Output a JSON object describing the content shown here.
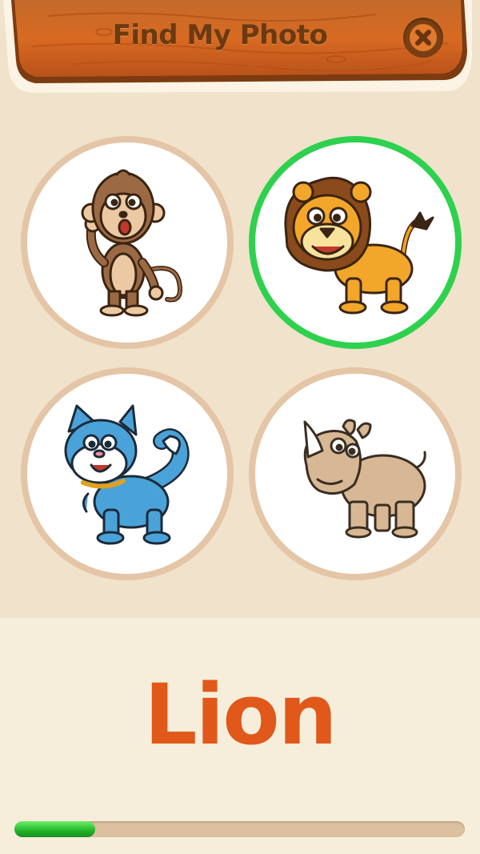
{
  "header": {
    "title": "Find My Photo",
    "close_icon": "close-icon"
  },
  "options": [
    {
      "animal": "monkey",
      "icon": "monkey-icon",
      "selected": false
    },
    {
      "animal": "lion",
      "icon": "lion-icon",
      "selected": true
    },
    {
      "animal": "cat",
      "icon": "cat-icon",
      "selected": false
    },
    {
      "animal": "rhino",
      "icon": "rhino-icon",
      "selected": false
    }
  ],
  "answer": {
    "word": "Lion"
  },
  "progress": {
    "fraction": 0.18
  },
  "colors": {
    "background": "#f0e2cb",
    "bottom_panel": "#f6eedb",
    "banner_wood": "#d8641e",
    "title": "#6b3a12",
    "tile_border": "#e4c5a6",
    "selected_border": "#2ed14e",
    "answer_text": "#e0581a",
    "progress_fill": "#21b329",
    "progress_track": "#dcc0a0"
  }
}
